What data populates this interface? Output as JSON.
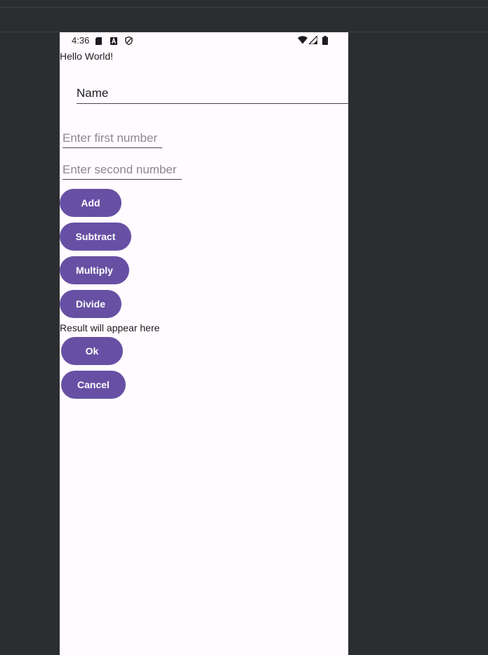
{
  "status_bar": {
    "time": "4:36",
    "left_icons": [
      "sd-card-icon",
      "a-badge-icon",
      "shield-icon"
    ],
    "right_icons": [
      "wifi-icon",
      "signal-icon",
      "battery-icon"
    ]
  },
  "main": {
    "hello_text": "Hello World!",
    "name_field_value": "Name",
    "first_number_placeholder": "Enter first number",
    "second_number_placeholder": "Enter second number",
    "buttons": {
      "add": "Add",
      "subtract": "Subtract",
      "multiply": "Multiply",
      "divide": "Divide",
      "ok": "Ok",
      "cancel": "Cancel"
    },
    "result_text": "Result will appear here"
  },
  "colors": {
    "accent": "#6750a4",
    "background": "#fffbfe",
    "ide_background": "#2b2d31"
  }
}
